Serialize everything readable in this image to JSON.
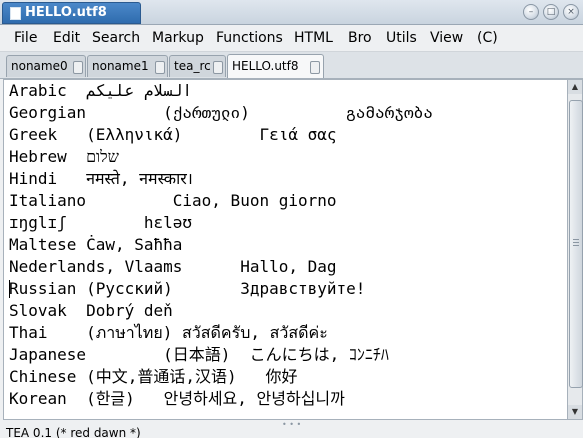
{
  "window": {
    "title": "HELLO.utf8",
    "controls": [
      "minimize-icon",
      "maximize-icon",
      "close-icon"
    ]
  },
  "menu": {
    "items": [
      "File",
      "Edit",
      "Search",
      "Markup",
      "Functions",
      "HTML",
      "Bro",
      "Utils",
      "View",
      "(C)"
    ]
  },
  "tabs": [
    {
      "label": "noname0",
      "active": false
    },
    {
      "label": "noname1",
      "active": false
    },
    {
      "label": "tea_rc",
      "active": false
    },
    {
      "label": "HELLO.utf8",
      "active": true
    }
  ],
  "editor": {
    "lines": [
      "Arabic  السلام عليكم",
      "Georgian        (ქართული)          გამარჯობა",
      "Greek   (Ελληνικά)        Γειά σας",
      "Hebrew  שלום",
      "Hindi   नमस्ते, नमस्कार।",
      "Italiano         Ciao, Buon giorno",
      "ɪŋglɪʃ        hɛləʊ",
      "Maltese Ċaw, Saħħa",
      "Nederlands, Vlaams      Hallo, Dag",
      "Russian (Русский)       Здравствуйте!",
      "Slovak  Dobrý deň",
      "Thai    (ภาษาไทย) สวัสดีครับ, สวัสดีค่ะ",
      "Japanese        (日本語)  こんにちは, ｺﾝﾆﾁﾊ",
      "Chinese (中文,普通话,汉语)   你好",
      "Korean  (한글)   안녕하세요, 안녕하십니까"
    ],
    "cursor_line": 10
  },
  "status": {
    "text": "TEA 0.1 (* red dawn *)"
  }
}
